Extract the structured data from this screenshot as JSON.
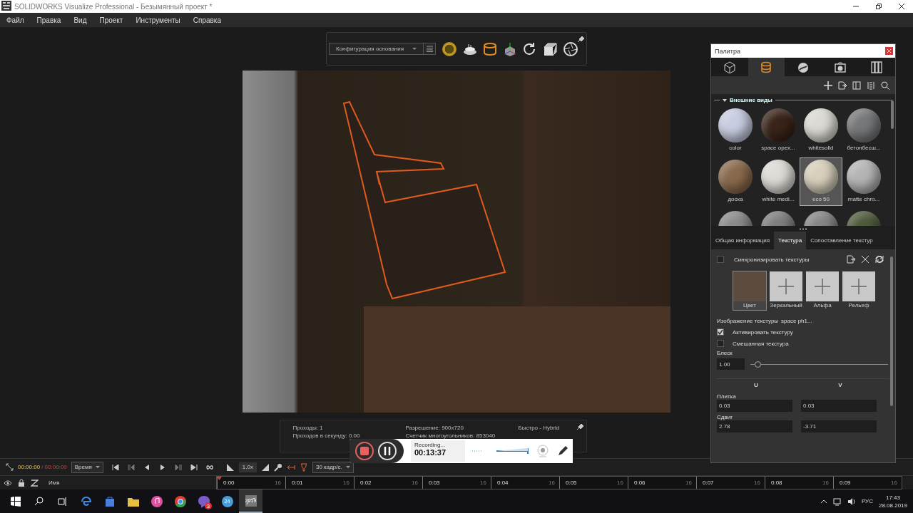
{
  "window": {
    "title": "SOLIDWORKS Visualize Professional - Безымянный проект *"
  },
  "menu": [
    "Файл",
    "Правка",
    "Вид",
    "Проект",
    "Инструменты",
    "Справка"
  ],
  "toolbar": {
    "configuration": "Конфигурация основания"
  },
  "status": {
    "passes": "Проходы: 1",
    "passes_per_second": "Проходов в секунду: 0.00",
    "resolution": "Разрешение: 900x720",
    "polygons": "Счетчик многоугольников: 853040",
    "mode": "Быстро - Hybrid"
  },
  "recording": {
    "status": "Recording...",
    "time": "00:13:37"
  },
  "palette": {
    "title": "Палитра",
    "tabs": [
      {
        "kind": "cube",
        "selected": false
      },
      {
        "kind": "appearance",
        "selected": true
      },
      {
        "kind": "scene",
        "selected": false
      },
      {
        "kind": "camera",
        "selected": false
      },
      {
        "kind": "library",
        "selected": false
      }
    ],
    "section": "Внешние виды",
    "appearances": [
      {
        "name": "color",
        "color": "#c9cde2",
        "selected": false
      },
      {
        "name": "space opex...",
        "color": "#3a2419",
        "selected": false
      },
      {
        "name": "whitesolid",
        "color": "#dcdad4",
        "selected": false
      },
      {
        "name": "бетонбесш...",
        "color": "#77787a",
        "selected": false
      },
      {
        "name": "доска",
        "color": "#8a6a4c",
        "selected": false
      },
      {
        "name": "white medi...",
        "color": "#dedcd6",
        "selected": false
      },
      {
        "name": "eco 50",
        "color": "#d8d0bc",
        "selected": true
      },
      {
        "name": "matte chro...",
        "color": "#b5b5b5",
        "selected": false
      },
      {
        "color": "#8a8a8a",
        "selected": false
      },
      {
        "color": "#7e7e7e",
        "selected": false
      },
      {
        "color": "#858585",
        "selected": false
      },
      {
        "color": "#4f5a3c",
        "selected": false
      }
    ],
    "detail_tabs": [
      {
        "label": "Общая информация",
        "selected": false
      },
      {
        "label": "Текстура",
        "selected": true
      },
      {
        "label": "Сопоставление текстур",
        "selected": false
      }
    ],
    "sync": {
      "label": "Синхронизировать текстуры",
      "checked": false
    },
    "texture_slots": [
      {
        "label": "Цвет",
        "kind": "image",
        "selected": true
      },
      {
        "label": "Зеркальный",
        "kind": "empty",
        "selected": false
      },
      {
        "label": "Альфа",
        "kind": "empty",
        "selected": false
      },
      {
        "label": "Рельеф",
        "kind": "empty",
        "selected": false
      }
    ],
    "texture_image": {
      "label": "Изображение текстуры",
      "value": "space ph1..."
    },
    "options": [
      {
        "label": "Активировать текстуру",
        "checked": true
      },
      {
        "label": "Смешанная текстура",
        "checked": false
      }
    ],
    "gloss": {
      "label": "Блеск",
      "value": "1.00",
      "level": 0.03
    },
    "uv": {
      "columns": [
        "U",
        "V"
      ],
      "rows": [
        {
          "label": "Плитка",
          "u": "0.03",
          "v": "0.03"
        },
        {
          "label": "Сдвиг",
          "u": "2.78",
          "v": "-3.71"
        }
      ]
    }
  },
  "timeline": {
    "current": "00:00:00",
    "total": "/ 00:00:00",
    "mode": "Время",
    "speed": "1.0x",
    "fps": "30 кадр/с.",
    "name_header": "Имя",
    "ticks": [
      {
        "label": "0:00",
        "minor": "16"
      },
      {
        "label": "0:01",
        "minor": "16"
      },
      {
        "label": "0:02",
        "minor": "16"
      },
      {
        "label": "0:03",
        "minor": "16"
      },
      {
        "label": "0:04",
        "minor": "16"
      },
      {
        "label": "0:05",
        "minor": "16"
      },
      {
        "label": "0:06",
        "minor": "16"
      },
      {
        "label": "0:07",
        "minor": "16"
      },
      {
        "label": "0:08",
        "minor": "16"
      },
      {
        "label": "0:09",
        "minor": "16"
      }
    ]
  },
  "taskbar": {
    "apps": [
      {
        "kind": "edge"
      },
      {
        "kind": "store"
      },
      {
        "kind": "folder"
      },
      {
        "kind": "music"
      },
      {
        "kind": "chrome"
      },
      {
        "kind": "viber",
        "badge": "3"
      },
      {
        "kind": "clock",
        "label": "24"
      },
      {
        "kind": "solidworks",
        "label": "2019",
        "selected": true
      }
    ],
    "language": "РУС",
    "time": "17:43",
    "date": "28.08.2019"
  }
}
